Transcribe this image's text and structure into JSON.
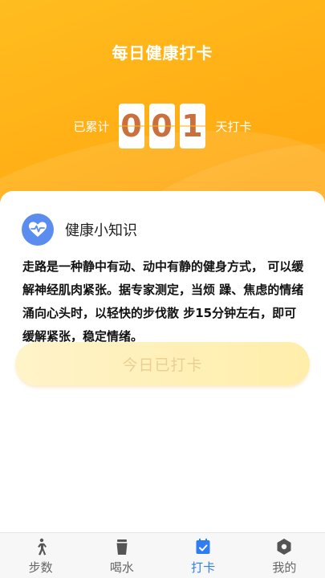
{
  "header": {
    "title": "每日健康打卡",
    "counter_prefix": "已累计",
    "counter_suffix": "天打卡",
    "counter_digits": [
      "0",
      "0",
      "1"
    ]
  },
  "tip": {
    "icon": "heart-pulse-icon",
    "title": "健康小知识",
    "text": "走路是一种静中有动、动中有静的健身方式， 可以缓解神经肌肉紧张。据专家测定，当烦 躁、焦虑的情绪涌向心头时，以轻快的步伐散 步15分钟左右，即可缓解紧张，稳定情绪。"
  },
  "checkin_button": {
    "label": "今日已打卡"
  },
  "tabbar": {
    "items": [
      {
        "label": "步数",
        "icon": "walking-icon"
      },
      {
        "label": "喝水",
        "icon": "cup-icon"
      },
      {
        "label": "打卡",
        "icon": "calendar-check-icon"
      },
      {
        "label": "我的",
        "icon": "profile-icon"
      }
    ],
    "active_index": 2
  },
  "colors": {
    "header_orange": "#ffae14",
    "digit_color": "#c9703d",
    "tip_icon_bg": "#5b8def",
    "active_tab": "#2f7df0",
    "button_text": "#e8cf93"
  }
}
